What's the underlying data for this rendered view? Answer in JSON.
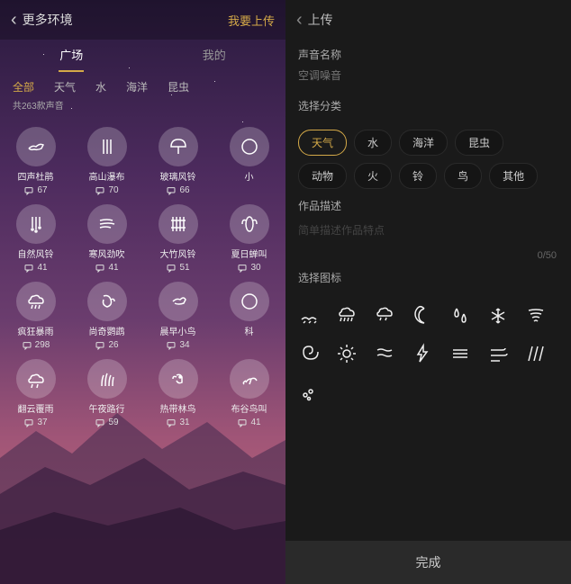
{
  "left": {
    "title": "更多环境",
    "upload": "我要上传",
    "tabs": [
      {
        "label": "广场",
        "active": true
      },
      {
        "label": "我的",
        "active": false
      }
    ],
    "cats": [
      {
        "label": "全部",
        "active": true
      },
      {
        "label": "天气",
        "active": false
      },
      {
        "label": "水",
        "active": false
      },
      {
        "label": "海洋",
        "active": false
      },
      {
        "label": "昆虫",
        "active": false
      }
    ],
    "count": "共263款声音",
    "rows": [
      [
        {
          "icon": "bird",
          "name": "四声杜鹃",
          "cnt": "67"
        },
        {
          "icon": "waterfall",
          "name": "高山瀑布",
          "cnt": "70"
        },
        {
          "icon": "umbrella",
          "name": "玻璃风铃",
          "cnt": "66"
        },
        {
          "icon": "partial",
          "name": "小",
          "cnt": ""
        }
      ],
      [
        {
          "icon": "chime",
          "name": "自然风铃",
          "cnt": "41"
        },
        {
          "icon": "wind",
          "name": "寒风劲吹",
          "cnt": "41"
        },
        {
          "icon": "bamboo",
          "name": "大竹风铃",
          "cnt": "51"
        },
        {
          "icon": "cicada",
          "name": "夏日蝉叫",
          "cnt": "30"
        }
      ],
      [
        {
          "icon": "raincloud",
          "name": "疯狂暴雨",
          "cnt": "298"
        },
        {
          "icon": "parrot",
          "name": "尚奇鹦鹉",
          "cnt": "26"
        },
        {
          "icon": "smallbird",
          "name": "晨早小鸟",
          "cnt": "34"
        },
        {
          "icon": "partial",
          "name": "科",
          "cnt": ""
        }
      ],
      [
        {
          "icon": "cloud",
          "name": "翻云覆雨",
          "cnt": "37"
        },
        {
          "icon": "grass",
          "name": "午夜路行",
          "cnt": "59"
        },
        {
          "icon": "bird2",
          "name": "热带林鸟",
          "cnt": "31"
        },
        {
          "icon": "bird3",
          "name": "布谷鸟叫",
          "cnt": "41"
        }
      ]
    ]
  },
  "right": {
    "title": "上传",
    "name_label": "声音名称",
    "name_placeholder": "空调噪音",
    "cat_label": "选择分类",
    "chips": [
      "天气",
      "水",
      "海洋",
      "昆虫",
      "动物",
      "火",
      "铃",
      "鸟",
      "其他"
    ],
    "chip_active": 0,
    "desc_label": "作品描述",
    "desc_placeholder": "简单描述作品特点",
    "charcount": "0/50",
    "iconsel_label": "选择图标",
    "done": "完成",
    "icons": [
      "sand",
      "rainheavy",
      "rainlight",
      "moon",
      "drops",
      "snow",
      "tornado",
      "spiral",
      "sun",
      "waves",
      "lightning",
      "lines",
      "windlines",
      "slant",
      "splash"
    ]
  }
}
